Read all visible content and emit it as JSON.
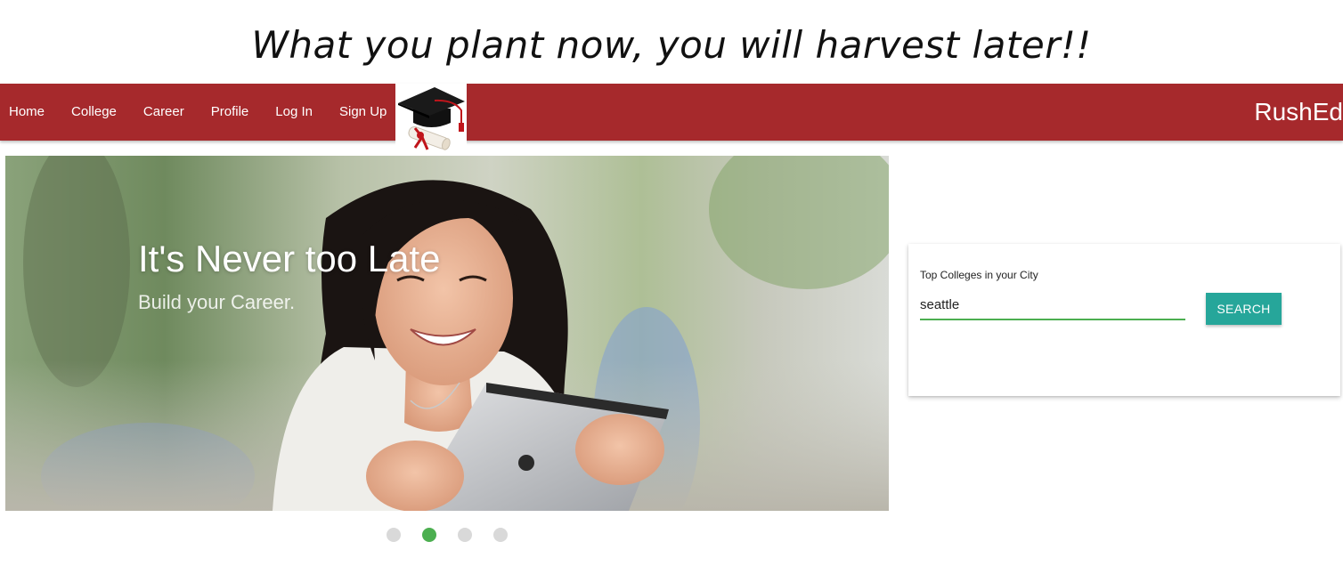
{
  "tagline": "What you plant now, you will harvest later!!",
  "nav": {
    "links": [
      "Home",
      "College",
      "Career",
      "Profile",
      "Log In",
      "Sign Up"
    ],
    "brand": "RushEd"
  },
  "hero": {
    "title": "It's Never too Late",
    "subtitle": "Build your Career."
  },
  "carousel": {
    "total_slides": 4,
    "active_slide": 2
  },
  "search_card": {
    "label": "Top Colleges in your City",
    "input_value": "seattle",
    "button_label": "SEARCH"
  },
  "colors": {
    "navbar": "#a6292c",
    "accent_green": "#4caf50",
    "button_teal": "#26a69a"
  }
}
